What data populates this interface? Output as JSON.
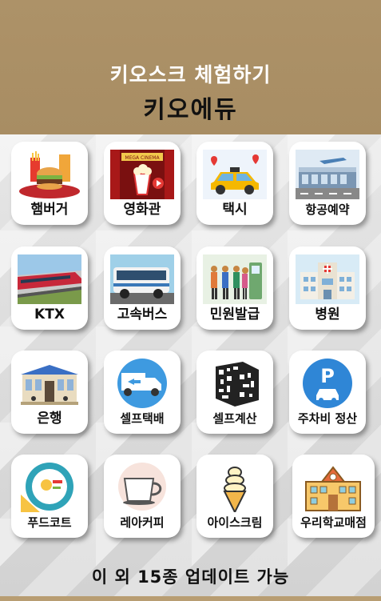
{
  "header": {
    "subtitle": "키오스크 체험하기",
    "title": "키오에듀"
  },
  "cards": [
    {
      "label": "햄버거",
      "icon": "hamburger-icon"
    },
    {
      "label": "영화관",
      "icon": "cinema-icon"
    },
    {
      "label": "택시",
      "icon": "taxi-icon"
    },
    {
      "label": "항공예약",
      "icon": "airport-icon"
    },
    {
      "label": "KTX",
      "icon": "train-icon"
    },
    {
      "label": "고속버스",
      "icon": "bus-icon"
    },
    {
      "label": "민원발급",
      "icon": "civil-service-kiosk-icon"
    },
    {
      "label": "병원",
      "icon": "hospital-icon"
    },
    {
      "label": "은행",
      "icon": "bank-icon"
    },
    {
      "label": "셀프택배",
      "icon": "delivery-truck-icon"
    },
    {
      "label": "셀프계산",
      "icon": "qr-code-icon"
    },
    {
      "label": "주차비 정산",
      "icon": "parking-icon"
    },
    {
      "label": "푸드코트",
      "icon": "food-court-icon"
    },
    {
      "label": "레아커피",
      "icon": "coffee-cup-icon"
    },
    {
      "label": "아이스크림",
      "icon": "ice-cream-icon"
    },
    {
      "label": "우리학교매점",
      "icon": "school-icon"
    }
  ],
  "cinema_sign": "MEGA CINEMA",
  "footer": "이 외 15종 업데이트 가능"
}
